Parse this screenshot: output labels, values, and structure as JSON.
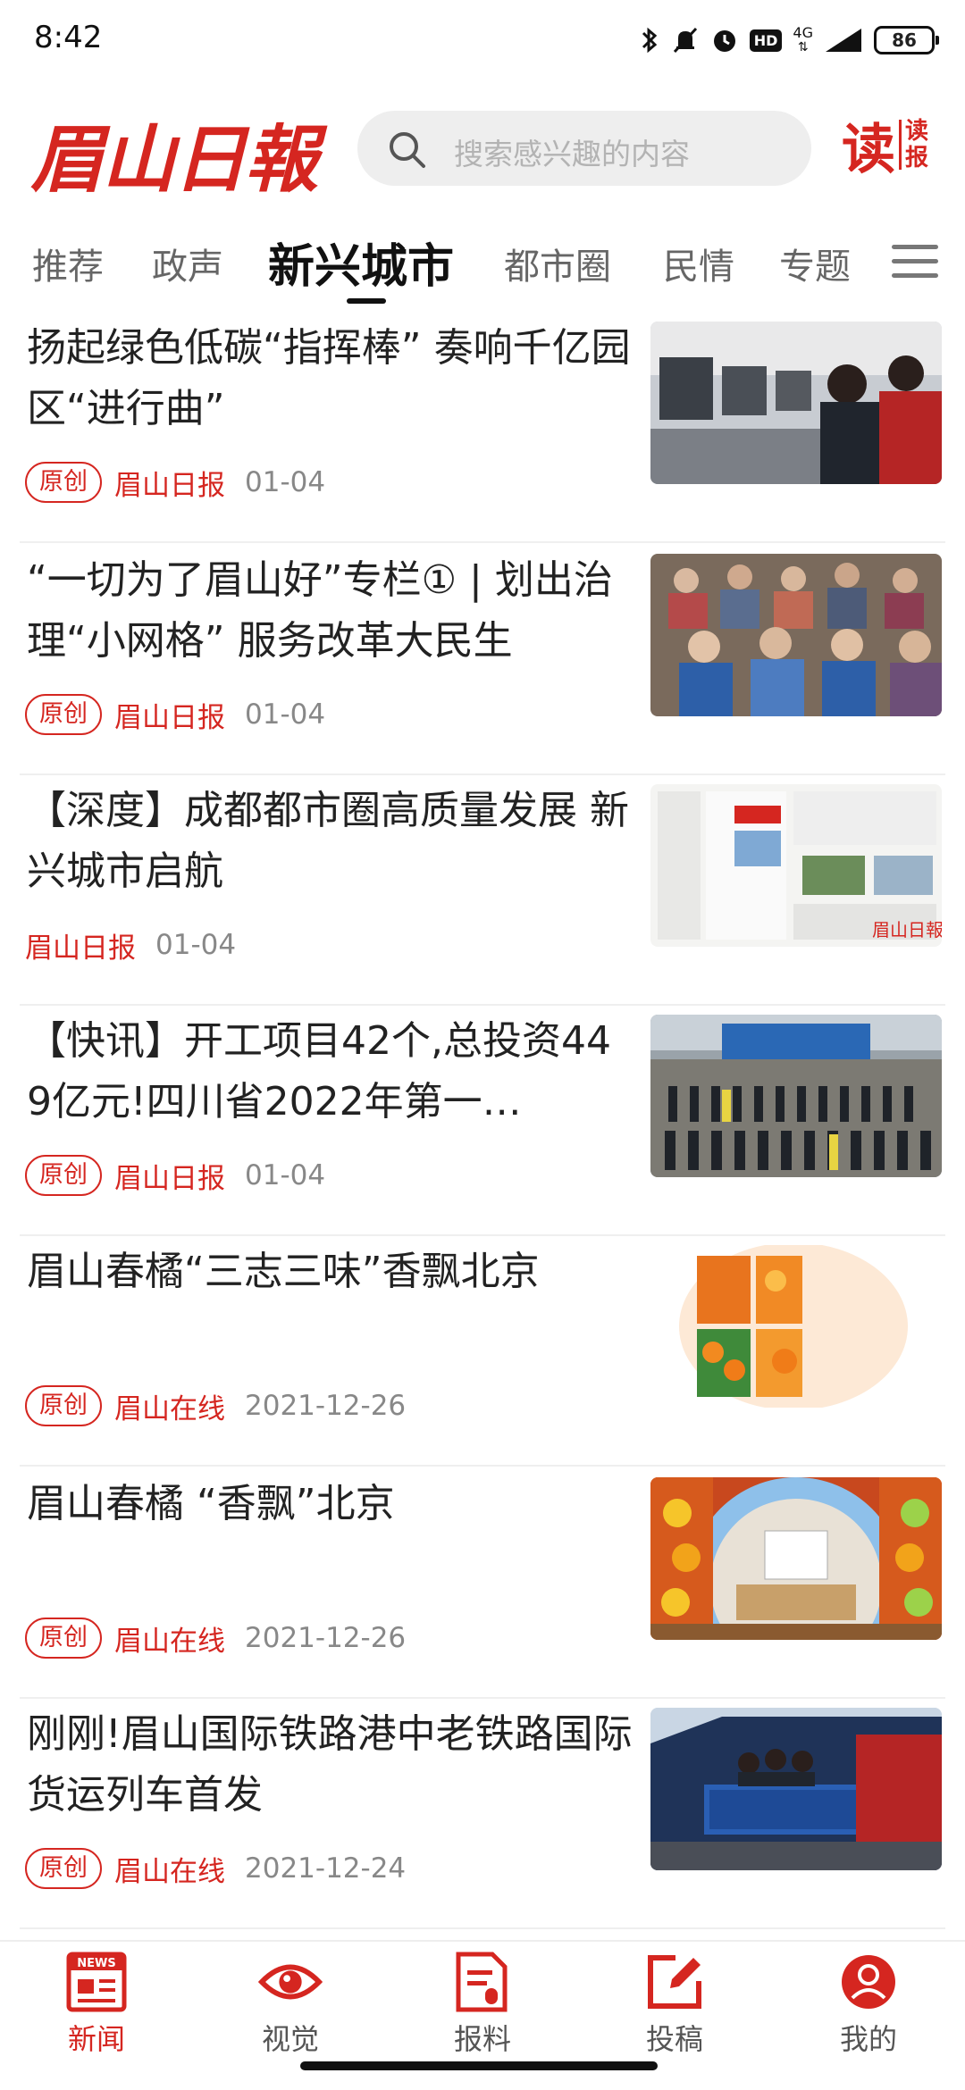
{
  "status_bar": {
    "time": "8:42",
    "network": "4G",
    "hd_badge": "HD",
    "battery": "86"
  },
  "header": {
    "logo": "眉山日報",
    "search_placeholder": "搜索感兴趣的内容",
    "read_paper_big": "读",
    "read_paper_small_1": "读",
    "read_paper_small_2": "报"
  },
  "tabs": [
    {
      "label": "推荐"
    },
    {
      "label": "政声"
    },
    {
      "label": "新兴城市"
    },
    {
      "label": "都市圈"
    },
    {
      "label": "民情"
    },
    {
      "label": "专题"
    }
  ],
  "news": [
    {
      "title": "扬起绿色低碳“指挥棒” 奏响千亿园区“进行曲”",
      "tag": "原创",
      "source": "眉山日报",
      "date": "01-04",
      "thumb": "office-workers"
    },
    {
      "title": "“一切为了眉山好”专栏① | 划出治理“小网格” 服务改革大民生",
      "tag": "原创",
      "source": "眉山日报",
      "date": "01-04",
      "thumb": "elderly-audience"
    },
    {
      "title": "【深度】成都都市圈高质量发展 新兴城市启航",
      "tag": "",
      "source": "眉山日报",
      "date": "01-04",
      "thumb": "newspaper-page"
    },
    {
      "title": "【快讯】开工项目42个,总投资449亿元!四川省2022年第一…",
      "tag": "原创",
      "source": "眉山日报",
      "date": "01-04",
      "thumb": "groundbreaking-ceremony"
    },
    {
      "title": "眉山春橘“三志三味”香飘北京",
      "tag": "原创",
      "source": "眉山在线",
      "date": "2021-12-26",
      "thumb": "oranges-collage"
    },
    {
      "title": "眉山春橘 “香飘”北京",
      "tag": "原创",
      "source": "眉山在线",
      "date": "2021-12-26",
      "thumb": "expo-booth"
    },
    {
      "title": "刚刚!眉山国际铁路港中老铁路国际货运列车首发",
      "tag": "原创",
      "source": "眉山在线",
      "date": "2021-12-24",
      "thumb": "freight-train"
    }
  ],
  "bottom_nav": [
    {
      "label": "新闻",
      "icon": "news-icon",
      "badge": "NEWS"
    },
    {
      "label": "视觉",
      "icon": "eye-icon"
    },
    {
      "label": "报料",
      "icon": "report-icon"
    },
    {
      "label": "投稿",
      "icon": "edit-icon"
    },
    {
      "label": "我的",
      "icon": "user-icon"
    }
  ],
  "colors": {
    "accent": "#d52620",
    "muted": "#888888"
  }
}
